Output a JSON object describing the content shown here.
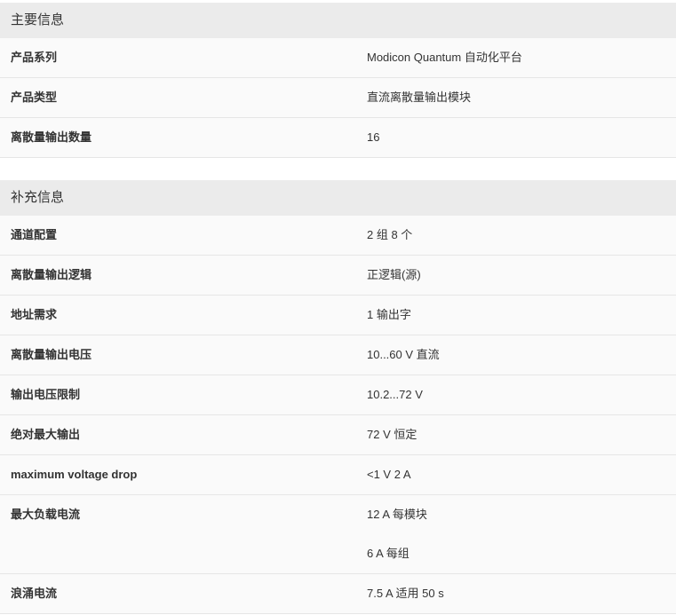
{
  "sections": [
    {
      "title": "主要信息",
      "rows": [
        {
          "key": "产品系列",
          "values": [
            "Modicon Quantum 自动化平台"
          ]
        },
        {
          "key": "产品类型",
          "values": [
            "直流离散量输出模块"
          ]
        },
        {
          "key": "离散量输出数量",
          "values": [
            "16"
          ]
        }
      ]
    },
    {
      "title": "补充信息",
      "rows": [
        {
          "key": "通道配置",
          "values": [
            "2 组 8 个"
          ]
        },
        {
          "key": "离散量输出逻辑",
          "values": [
            "正逻辑(源)"
          ]
        },
        {
          "key": "地址需求",
          "values": [
            "1 输出字"
          ]
        },
        {
          "key": "离散量输出电压",
          "values": [
            "10...60 V 直流"
          ]
        },
        {
          "key": "输出电压限制",
          "values": [
            "10.2...72 V"
          ]
        },
        {
          "key": "绝对最大输出",
          "values": [
            "72 V 恒定"
          ]
        },
        {
          "key": "maximum voltage drop",
          "values": [
            "<1 V 2 A"
          ]
        },
        {
          "key": "最大负载电流",
          "values": [
            "12 A 每模块",
            "6 A 每组"
          ]
        },
        {
          "key": "浪涌电流",
          "values": [
            "7.5 A 适用 50 s"
          ]
        }
      ]
    }
  ]
}
